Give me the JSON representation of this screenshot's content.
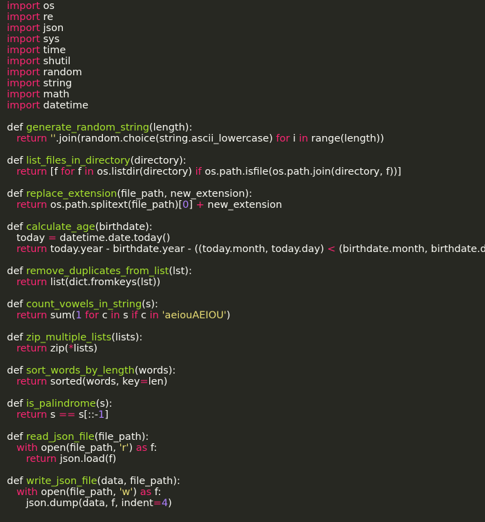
{
  "theme": {
    "background": "#272822",
    "keyword": "#f92672",
    "function": "#a6e22e",
    "string": "#e6db74",
    "number": "#ae81ff",
    "text": "#f8f8f2"
  },
  "code": {
    "lines": [
      [
        [
          "kw",
          "import"
        ],
        [
          "p",
          " os"
        ]
      ],
      [
        [
          "kw",
          "import"
        ],
        [
          "p",
          " re"
        ]
      ],
      [
        [
          "kw",
          "import"
        ],
        [
          "p",
          " json"
        ]
      ],
      [
        [
          "kw",
          "import"
        ],
        [
          "p",
          " sys"
        ]
      ],
      [
        [
          "kw",
          "import"
        ],
        [
          "p",
          " time"
        ]
      ],
      [
        [
          "kw",
          "import"
        ],
        [
          "p",
          " shutil"
        ]
      ],
      [
        [
          "kw",
          "import"
        ],
        [
          "p",
          " random"
        ]
      ],
      [
        [
          "kw",
          "import"
        ],
        [
          "p",
          " string"
        ]
      ],
      [
        [
          "kw",
          "import"
        ],
        [
          "p",
          " math"
        ]
      ],
      [
        [
          "kw",
          "import"
        ],
        [
          "p",
          " datetime"
        ]
      ],
      [],
      [
        [
          "p",
          "def "
        ],
        [
          "fn",
          "generate_random_string"
        ],
        [
          "p",
          "(length):"
        ]
      ],
      [
        [
          "p",
          "   "
        ],
        [
          "kw",
          "return"
        ],
        [
          "p",
          " "
        ],
        [
          "str",
          "''"
        ],
        [
          "p",
          ".join(random.choice(string.ascii_lowercase) "
        ],
        [
          "kw",
          "for"
        ],
        [
          "p",
          " i "
        ],
        [
          "kw",
          "in"
        ],
        [
          "p",
          " range(length))"
        ]
      ],
      [],
      [
        [
          "p",
          "def "
        ],
        [
          "fn",
          "list_files_in_directory"
        ],
        [
          "p",
          "(directory):"
        ]
      ],
      [
        [
          "p",
          "   "
        ],
        [
          "kw",
          "return"
        ],
        [
          "p",
          " [f "
        ],
        [
          "kw",
          "for"
        ],
        [
          "p",
          " f "
        ],
        [
          "kw",
          "in"
        ],
        [
          "p",
          " os.listdir(directory) "
        ],
        [
          "kw",
          "if"
        ],
        [
          "p",
          " os.path.isfile(os.path.join(directory, f))]"
        ]
      ],
      [],
      [
        [
          "p",
          "def "
        ],
        [
          "fn",
          "replace_extension"
        ],
        [
          "p",
          "(file_path, new_extension):"
        ]
      ],
      [
        [
          "p",
          "   "
        ],
        [
          "kw",
          "return"
        ],
        [
          "p",
          " os.path.splitext(file_path)["
        ],
        [
          "num",
          "0"
        ],
        [
          "p",
          "] "
        ],
        [
          "op",
          "+"
        ],
        [
          "p",
          " new_extension"
        ]
      ],
      [],
      [
        [
          "p",
          "def "
        ],
        [
          "fn",
          "calculate_age"
        ],
        [
          "p",
          "(birthdate):"
        ]
      ],
      [
        [
          "p",
          "   today "
        ],
        [
          "op",
          "="
        ],
        [
          "p",
          " datetime.date.today()"
        ]
      ],
      [
        [
          "p",
          "   "
        ],
        [
          "kw",
          "return"
        ],
        [
          "p",
          " today.year - birthdate.year - ((today.month, today.day) "
        ],
        [
          "op",
          "<"
        ],
        [
          "p",
          " (birthdate.month, birthdate.day))"
        ]
      ],
      [],
      [
        [
          "p",
          "def "
        ],
        [
          "fn",
          "remove_duplicates_from_list"
        ],
        [
          "p",
          "(lst):"
        ]
      ],
      [
        [
          "p",
          "   "
        ],
        [
          "kw",
          "return"
        ],
        [
          "p",
          " list(dict.fromkeys(lst))"
        ]
      ],
      [],
      [
        [
          "p",
          "def "
        ],
        [
          "fn",
          "count_vowels_in_string"
        ],
        [
          "p",
          "(s):"
        ]
      ],
      [
        [
          "p",
          "   "
        ],
        [
          "kw",
          "return"
        ],
        [
          "p",
          " sum("
        ],
        [
          "num",
          "1"
        ],
        [
          "p",
          " "
        ],
        [
          "kw",
          "for"
        ],
        [
          "p",
          " c "
        ],
        [
          "kw",
          "in"
        ],
        [
          "p",
          " s "
        ],
        [
          "kw",
          "if"
        ],
        [
          "p",
          " c "
        ],
        [
          "kw",
          "in"
        ],
        [
          "p",
          " "
        ],
        [
          "str",
          "'aeiouAEIOU'"
        ],
        [
          "p",
          ")"
        ]
      ],
      [],
      [
        [
          "p",
          "def "
        ],
        [
          "fn",
          "zip_multiple_lists"
        ],
        [
          "p",
          "(lists):"
        ]
      ],
      [
        [
          "p",
          "   "
        ],
        [
          "kw",
          "return"
        ],
        [
          "p",
          " zip("
        ],
        [
          "op",
          "*"
        ],
        [
          "p",
          "lists)"
        ]
      ],
      [],
      [
        [
          "p",
          "def "
        ],
        [
          "fn",
          "sort_words_by_length"
        ],
        [
          "p",
          "(words):"
        ]
      ],
      [
        [
          "p",
          "   "
        ],
        [
          "kw",
          "return"
        ],
        [
          "p",
          " sorted(words, key"
        ],
        [
          "op",
          "="
        ],
        [
          "p",
          "len)"
        ]
      ],
      [],
      [
        [
          "p",
          "def "
        ],
        [
          "fn",
          "is_palindrome"
        ],
        [
          "p",
          "(s):"
        ]
      ],
      [
        [
          "p",
          "   "
        ],
        [
          "kw",
          "return"
        ],
        [
          "p",
          " s "
        ],
        [
          "op",
          "=="
        ],
        [
          "p",
          " s[::-"
        ],
        [
          "num",
          "1"
        ],
        [
          "p",
          "]"
        ]
      ],
      [],
      [
        [
          "p",
          "def "
        ],
        [
          "fn",
          "read_json_file"
        ],
        [
          "p",
          "(file_path):"
        ]
      ],
      [
        [
          "p",
          "   "
        ],
        [
          "kw",
          "with"
        ],
        [
          "p",
          " open(file_path, "
        ],
        [
          "str",
          "'r'"
        ],
        [
          "p",
          ") "
        ],
        [
          "kw",
          "as"
        ],
        [
          "p",
          " f:"
        ]
      ],
      [
        [
          "p",
          "      "
        ],
        [
          "kw",
          "return"
        ],
        [
          "p",
          " json.load(f)"
        ]
      ],
      [],
      [
        [
          "p",
          "def "
        ],
        [
          "fn",
          "write_json_file"
        ],
        [
          "p",
          "(data, file_path):"
        ]
      ],
      [
        [
          "p",
          "   "
        ],
        [
          "kw",
          "with"
        ],
        [
          "p",
          " open(file_path, "
        ],
        [
          "str",
          "'w'"
        ],
        [
          "p",
          ") "
        ],
        [
          "kw",
          "as"
        ],
        [
          "p",
          " f:"
        ]
      ],
      [
        [
          "p",
          "      json.dump(data, f, indent"
        ],
        [
          "op",
          "="
        ],
        [
          "num",
          "4"
        ],
        [
          "p",
          ")"
        ]
      ]
    ]
  }
}
